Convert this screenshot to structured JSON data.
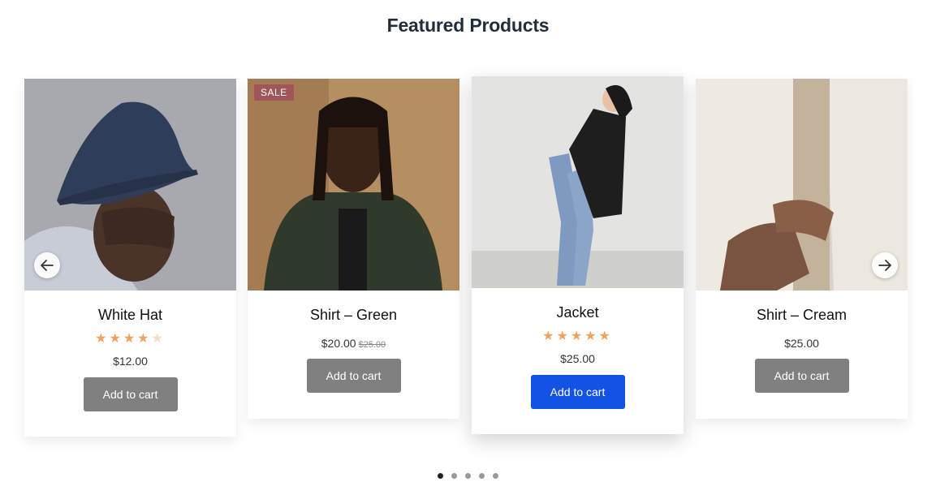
{
  "section": {
    "title": "Featured Products"
  },
  "products": [
    {
      "name": "White Hat",
      "price": "$12.00",
      "old_price": "",
      "rating": 4,
      "rating_max": 5,
      "button": "Add to cart",
      "badge": ""
    },
    {
      "name": "Shirt – Green",
      "price": "$20.00",
      "old_price": "$25.00",
      "button": "Add to cart",
      "badge": "SALE"
    },
    {
      "name": "Jacket",
      "price": "$25.00",
      "old_price": "",
      "rating": 5,
      "rating_max": 5,
      "button": "Add to cart",
      "badge": ""
    },
    {
      "name": "Shirt – Cream",
      "price": "$25.00",
      "old_price": "",
      "button": "Add to cart",
      "badge": ""
    }
  ],
  "pagination": {
    "count": 5,
    "active": 1
  },
  "icons": {
    "prev": "arrow-left-icon",
    "next": "arrow-right-icon",
    "star": "star-icon"
  },
  "colors": {
    "primary_button": "#1253e6",
    "default_button": "#808080",
    "sale_badge": "#a05558",
    "star": "#f0a25c"
  }
}
